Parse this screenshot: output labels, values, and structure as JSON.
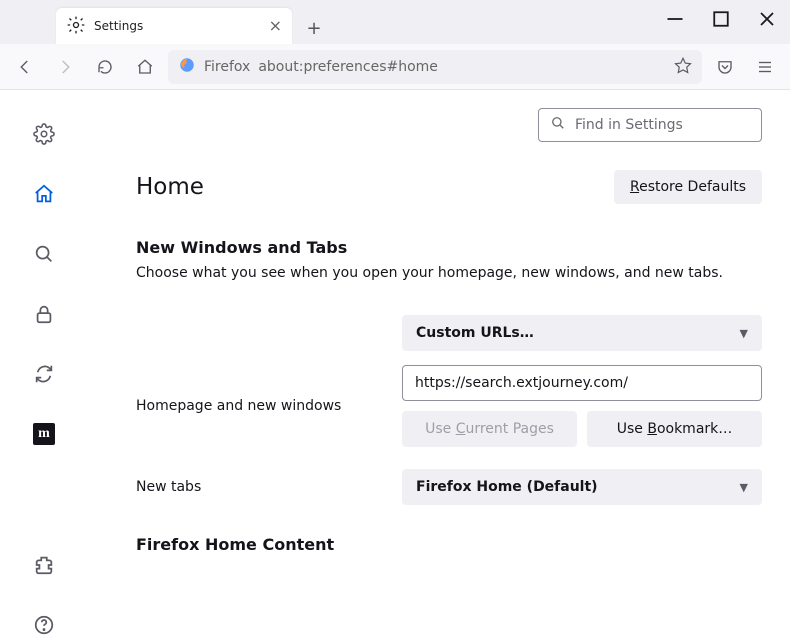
{
  "window": {
    "title": "Settings"
  },
  "urlbar": {
    "identity": "Firefox",
    "url": "about:preferences#home"
  },
  "search": {
    "placeholder": "Find in Settings"
  },
  "page": {
    "title": "Home",
    "restore": "Restore Defaults",
    "section1": {
      "heading": "New Windows and Tabs",
      "desc": "Choose what you see when you open your homepage, new windows, and new tabs.",
      "select1": "Custom URLs…",
      "label1": "Homepage and new windows",
      "url_value": "https://search.extjourney.com/",
      "btn_current": "Use Current Pages",
      "btn_bookmark": "Use Bookmark…",
      "label2": "New tabs",
      "select2": "Firefox Home (Default)"
    },
    "section2": {
      "heading": "Firefox Home Content"
    }
  }
}
